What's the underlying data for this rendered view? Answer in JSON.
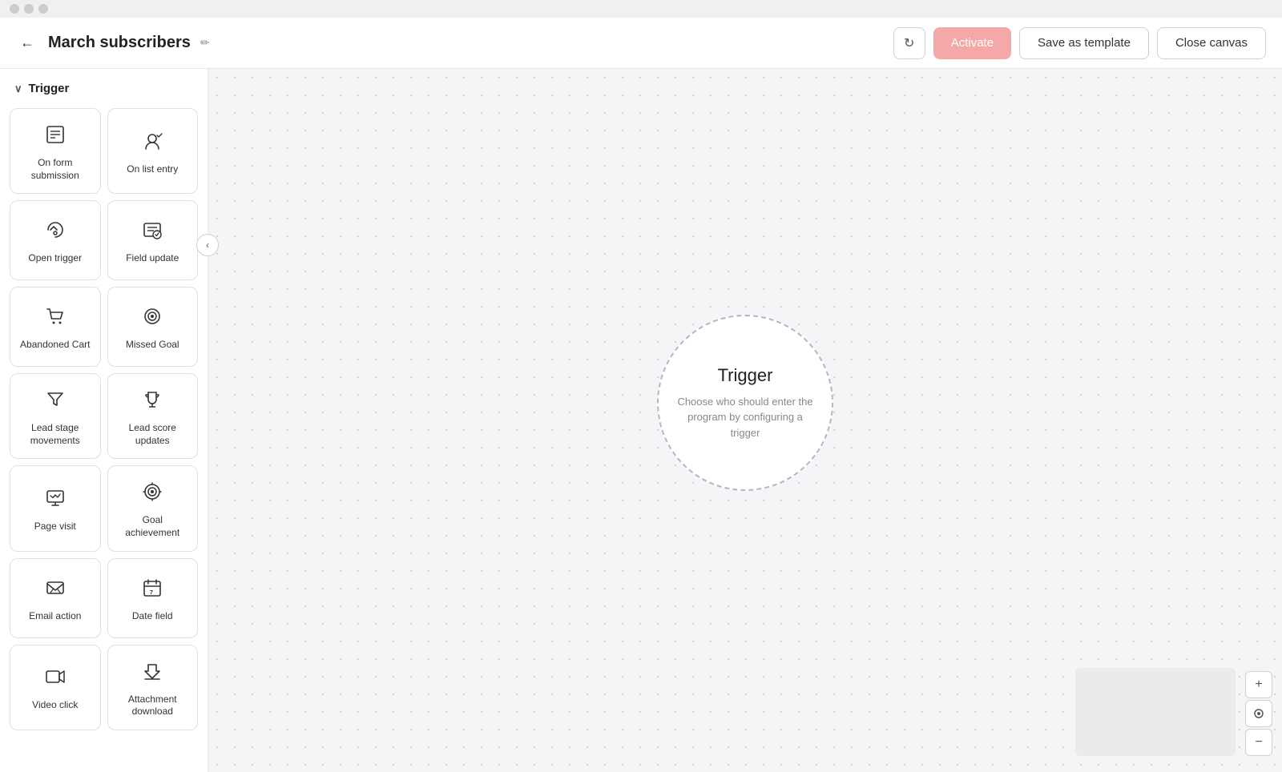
{
  "titlebar": {
    "dots": [
      "dot1",
      "dot2",
      "dot3"
    ]
  },
  "header": {
    "back_icon": "←",
    "title": "March subscribers",
    "edit_icon": "✏",
    "refresh_icon": "↻",
    "activate_label": "Activate",
    "save_template_label": "Save as template",
    "close_canvas_label": "Close canvas"
  },
  "sidebar": {
    "collapse_icon": "‹",
    "section_label": "Trigger",
    "chevron": "∨",
    "trigger_cards": [
      {
        "id": "on-form-submission",
        "label": "On form submission",
        "icon": "form"
      },
      {
        "id": "on-list-entry",
        "label": "On list entry",
        "icon": "list-entry"
      },
      {
        "id": "open-trigger",
        "label": "Open trigger",
        "icon": "open-trigger"
      },
      {
        "id": "field-update",
        "label": "Field update",
        "icon": "field-update"
      },
      {
        "id": "abandoned-cart",
        "label": "Abandoned Cart",
        "icon": "cart"
      },
      {
        "id": "missed-goal",
        "label": "Missed Goal",
        "icon": "target"
      },
      {
        "id": "lead-stage-movements",
        "label": "Lead stage movements",
        "icon": "funnel"
      },
      {
        "id": "lead-score-updates",
        "label": "Lead score updates",
        "icon": "trophy"
      },
      {
        "id": "page-visit",
        "label": "Page visit",
        "icon": "monitor"
      },
      {
        "id": "goal-achievement",
        "label": "Goal achievement",
        "icon": "goal-target"
      },
      {
        "id": "email-action",
        "label": "Email action",
        "icon": "email"
      },
      {
        "id": "date-field",
        "label": "Date field",
        "icon": "calendar"
      },
      {
        "id": "video-click",
        "label": "Video click",
        "icon": "video"
      },
      {
        "id": "attachment-download",
        "label": "Attachment download",
        "icon": "download"
      }
    ]
  },
  "canvas": {
    "trigger_node": {
      "title": "Trigger",
      "description": "Choose who should enter the program by configuring a trigger"
    }
  },
  "zoom_controls": {
    "zoom_in": "+",
    "zoom_reset": "⊙",
    "zoom_out": "−"
  }
}
